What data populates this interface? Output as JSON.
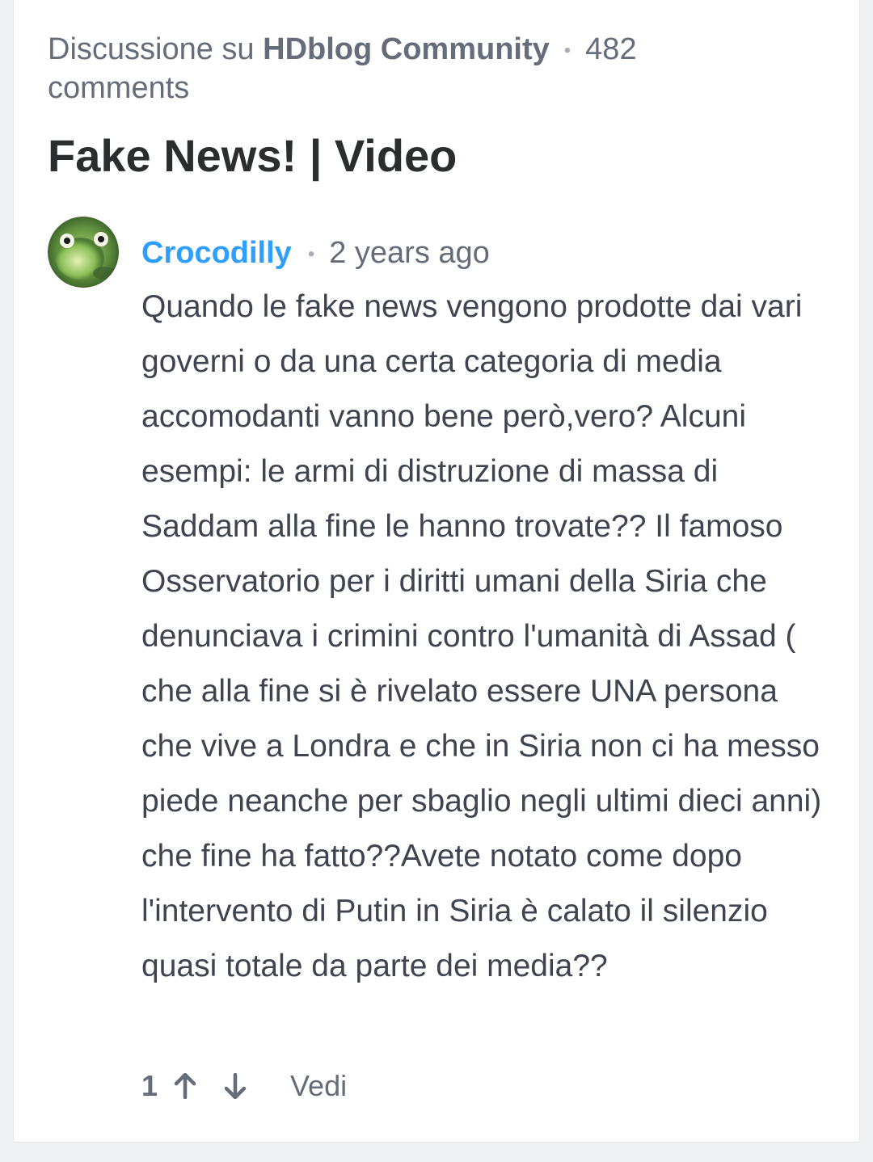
{
  "thread": {
    "prefix": "Discussione su",
    "community": "HDblog Community",
    "separator": "•",
    "comment_count": "482 comments",
    "title": "Fake News! | Video"
  },
  "comment": {
    "author": "Crocodilly",
    "separator": "•",
    "time": "2 years ago",
    "text": "Quando le fake news vengono prodotte dai vari governi o da una certa categoria di media accomodanti vanno bene però,vero? Alcuni esempi: le armi di distruzione di massa di Saddam alla fine le hanno trovate?? Il famoso Osservatorio per i diritti umani della Siria che denunciava i crimini contro l'umanità di Assad ( che alla fine si è rivelato essere UNA persona che vive a Londra e che in Siria non ci ha messo piede neanche per sbaglio negli ultimi dieci anni) che fine ha fatto??Avete notato come dopo l'intervento di Putin in Siria è calato il silenzio quasi totale da parte dei media??",
    "votes": "1",
    "reply_label": "Vedi"
  },
  "icons": {
    "upvote": "arrow-up-icon",
    "downvote": "arrow-down-icon",
    "avatar": "frog-avatar"
  },
  "colors": {
    "author_link": "#2e9fff",
    "text": "#3f4550",
    "meta": "#656c7a",
    "title": "#2a2e2e"
  }
}
